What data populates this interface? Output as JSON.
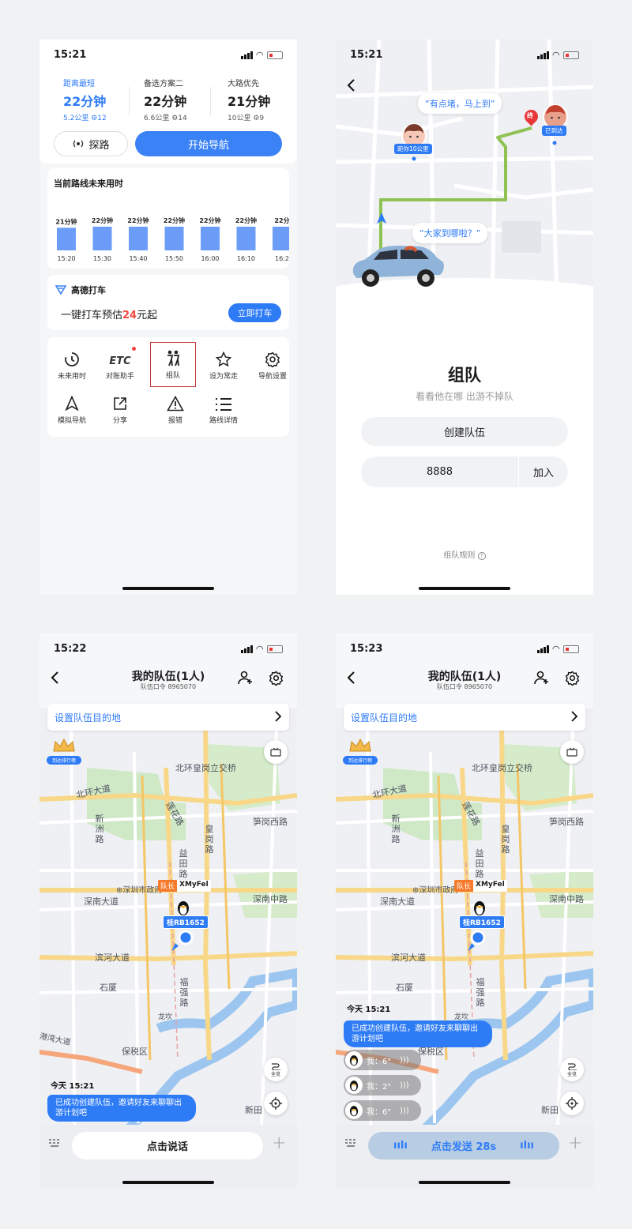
{
  "phone1": {
    "status": {
      "time": "15:21"
    },
    "routes": [
      {
        "name": "距离最短",
        "time": "22分钟",
        "dist": "5.2公里",
        "lights": "12",
        "selected": true
      },
      {
        "name": "备选方案二",
        "time": "22分钟",
        "dist": "6.6公里",
        "lights": "14",
        "selected": false
      },
      {
        "name": "大路优先",
        "time": "21分钟",
        "dist": "10公里",
        "lights": "9",
        "selected": false
      }
    ],
    "explore_label": "探路",
    "start_label": "开始导航",
    "future": {
      "title": "当前路线未来用时"
    },
    "taxi": {
      "brand": "高德打车",
      "prefix": "一键打车预估",
      "price": "24",
      "suffix": "元起",
      "button": "立即打车"
    },
    "tools": [
      {
        "label": "未来用时",
        "icon": "clock-icon"
      },
      {
        "label": "对账助手",
        "icon": "etc-icon"
      },
      {
        "label": "组队",
        "icon": "team-icon"
      },
      {
        "label": "设为常走",
        "icon": "star-icon"
      },
      {
        "label": "导航设置",
        "icon": "gear-icon"
      },
      {
        "label": "模拟导航",
        "icon": "navigation-arrow-icon"
      },
      {
        "label": "分享",
        "icon": "share-icon"
      },
      {
        "label": "报错",
        "icon": "warning-icon"
      },
      {
        "label": "路线详情",
        "icon": "list-icon"
      }
    ],
    "etc_text": "ETC"
  },
  "chart_data": {
    "type": "bar",
    "title": "当前路线未来用时",
    "categories": [
      "15:20",
      "15:30",
      "15:40",
      "15:50",
      "16:00",
      "16:10",
      "16:2"
    ],
    "values": [
      21,
      22,
      22,
      22,
      22,
      22,
      22
    ],
    "labels": [
      "21分钟",
      "22分钟",
      "22分钟",
      "22分钟",
      "22分钟",
      "22分钟",
      "22分"
    ],
    "ylim": [
      0,
      22
    ],
    "colors": {
      "bar": "#6b9cf8"
    }
  },
  "phone2": {
    "status": {
      "time": "15:21"
    },
    "bubble1": "“有点堵，马上到”",
    "bubble2": "“大家到哪啦？”",
    "tag_distance": "距你10公里",
    "tag_arrived": "已到达",
    "end_marker": "终",
    "title": "组队",
    "subtitle": "看看他在哪 出游不掉队",
    "create_label": "创建队伍",
    "code_value": "8888",
    "join_label": "加入",
    "rules_label": "组队规则"
  },
  "phone3": {
    "status": {
      "time": "15:22"
    },
    "title": "我的队伍(1人)",
    "subtitle": "队伍口令 8965070",
    "dest_label": "设置队伍目的地",
    "rank_badge": "到达排行榜",
    "fullview_label": "全览",
    "leader_tag": "队长",
    "leader_name": "XMyFel",
    "plate": "桂RB1652",
    "chat_time": "今天 15:21",
    "chat_msg": "已成功创建队伍，邀请好友来聊聊出游计划吧",
    "speak_label": "点击说话"
  },
  "phone4": {
    "status": {
      "time": "15:23"
    },
    "title": "我的队伍(1人)",
    "subtitle": "队伍口令 8965070",
    "dest_label": "设置队伍目的地",
    "rank_badge": "到达排行榜",
    "fullview_label": "全览",
    "leader_tag": "队长",
    "leader_name": "XMyFel",
    "plate": "桂RB1652",
    "chat_time": "今天 15:21",
    "chat_msg": "已成功创建队伍，邀请好友来聊聊出游计划吧",
    "voices": [
      {
        "label": "我：6\""
      },
      {
        "label": "我：2\""
      },
      {
        "label": "我：6\""
      }
    ],
    "send_label": "点击发送 28s"
  },
  "map_labels": {
    "north_bridge": "北环皇岗立交桥",
    "north_ring": "北环大道",
    "lianhua": "莲花路",
    "sungang": "笋岗西路",
    "xinzhou": "新洲路",
    "huanggang": "皇岗路",
    "yitian": "益田路",
    "gov": "深圳市政府",
    "shennan": "深南大道",
    "shennan_mid": "深南中路",
    "binhe": "滨河大道",
    "shixia": "石厦",
    "fuqiang": "福强路",
    "longkou": "龙坎",
    "harbor": "港湾大道",
    "baoshui": "保税区",
    "xintian": "新田"
  }
}
